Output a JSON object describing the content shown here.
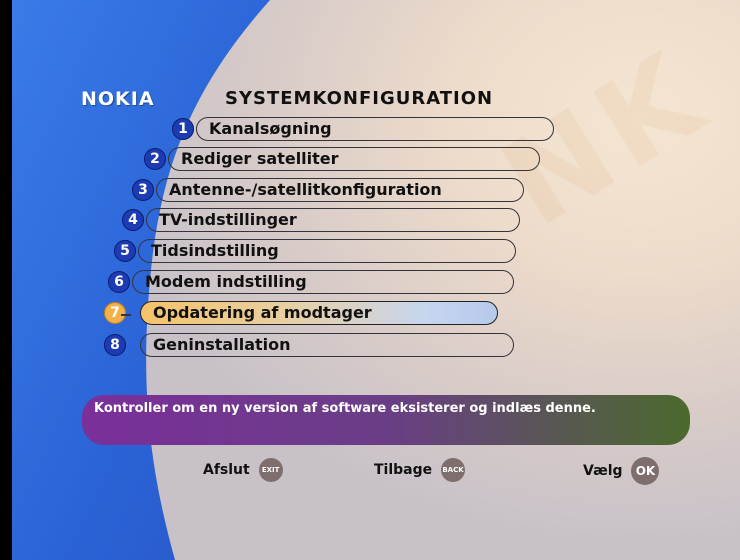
{
  "header": {
    "logo": "NOKIA",
    "title": "SYSTEMKONFIGURATION"
  },
  "menu": {
    "items": [
      {
        "num": "1",
        "label": "Kanalsøgning",
        "selected": false
      },
      {
        "num": "2",
        "label": "Rediger satelliter",
        "selected": false
      },
      {
        "num": "3",
        "label": "Antenne-/satellitkonfiguration",
        "selected": false
      },
      {
        "num": "4",
        "label": "TV-indstillinger",
        "selected": false
      },
      {
        "num": "5",
        "label": "Tidsindstilling",
        "selected": false
      },
      {
        "num": "6",
        "label": "Modem indstilling",
        "selected": false
      },
      {
        "num": "7",
        "label": "Opdatering af modtager",
        "selected": true
      },
      {
        "num": "8",
        "label": "Geninstallation",
        "selected": false
      }
    ]
  },
  "description": "Kontroller om en ny version af software eksisterer og indlæs denne.",
  "footer": {
    "exit_label": "Afslut",
    "exit_icon_text": "EXIT",
    "back_label": "Tilbage",
    "back_icon_text": "BACK",
    "ok_label": "Vælg",
    "ok_icon_text": "OK"
  },
  "colors": {
    "number_blue": "#1d3cb4",
    "selected_orange": "#f3b14a",
    "desc_purple": "#7a2f9a",
    "desc_green": "#4b6a2c"
  }
}
